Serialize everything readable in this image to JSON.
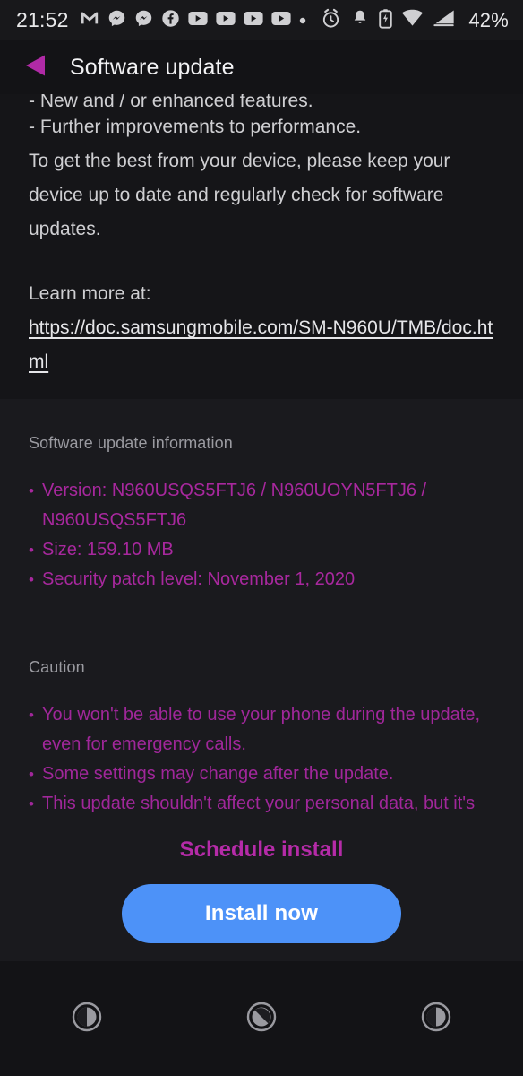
{
  "status_bar": {
    "time": "21:52",
    "battery_percent": "42%",
    "left_icons": [
      "gmail-icon",
      "messenger-icon",
      "messenger-icon",
      "facebook-icon",
      "youtube-icon",
      "youtube-icon",
      "youtube-icon",
      "youtube-icon",
      "more-notifications-dot-icon"
    ],
    "right_icons": [
      "alarm-icon",
      "notification-bell-icon",
      "battery-charging-icon",
      "wifi-icon",
      "signal-icon"
    ]
  },
  "header": {
    "back_icon": "back-triangle-icon",
    "title": "Software update"
  },
  "description": {
    "clipped_line": "- New and / or enhanced features.",
    "line2": "- Further improvements to performance.",
    "paragraph": "To get the best from your device, please keep your device up to date and regularly check for software updates.",
    "learn_more_label": "Learn more at:",
    "learn_more_url": "https://doc.samsungmobile.com/SM-N960U/TMB/doc.html"
  },
  "update_info": {
    "heading": "Software update information",
    "items": [
      "Version: N960USQS5FTJ6 / N960UOYN5FTJ6 / N960USQS5FTJ6",
      "Size: 159.10 MB",
      "Security patch level: November 1, 2020"
    ]
  },
  "caution": {
    "heading": "Caution",
    "items": [
      "You won't be able to use your phone during the update, even for emergency calls.",
      "Some settings may change after the update.",
      "This update shouldn't affect your personal data, but it's always a good idea to back up your data just in case."
    ]
  },
  "actions": {
    "schedule_label": "Schedule install",
    "install_label": "Install now"
  },
  "nav_bar": {
    "buttons": [
      {
        "name": "recents-button",
        "icon": "circle-half-right-icon"
      },
      {
        "name": "home-button",
        "icon": "circle-diagonal-icon"
      },
      {
        "name": "back-button",
        "icon": "circle-half-right-icon"
      }
    ]
  },
  "colors": {
    "background": "#131316",
    "panel": "#1a1a1e",
    "accent_magenta": "#a8289e",
    "accent_magenta_bright": "#b52ba8",
    "install_button_blue": "#4d92f8",
    "text_primary": "#e8e8ea",
    "text_secondary": "#9a9aa0"
  }
}
